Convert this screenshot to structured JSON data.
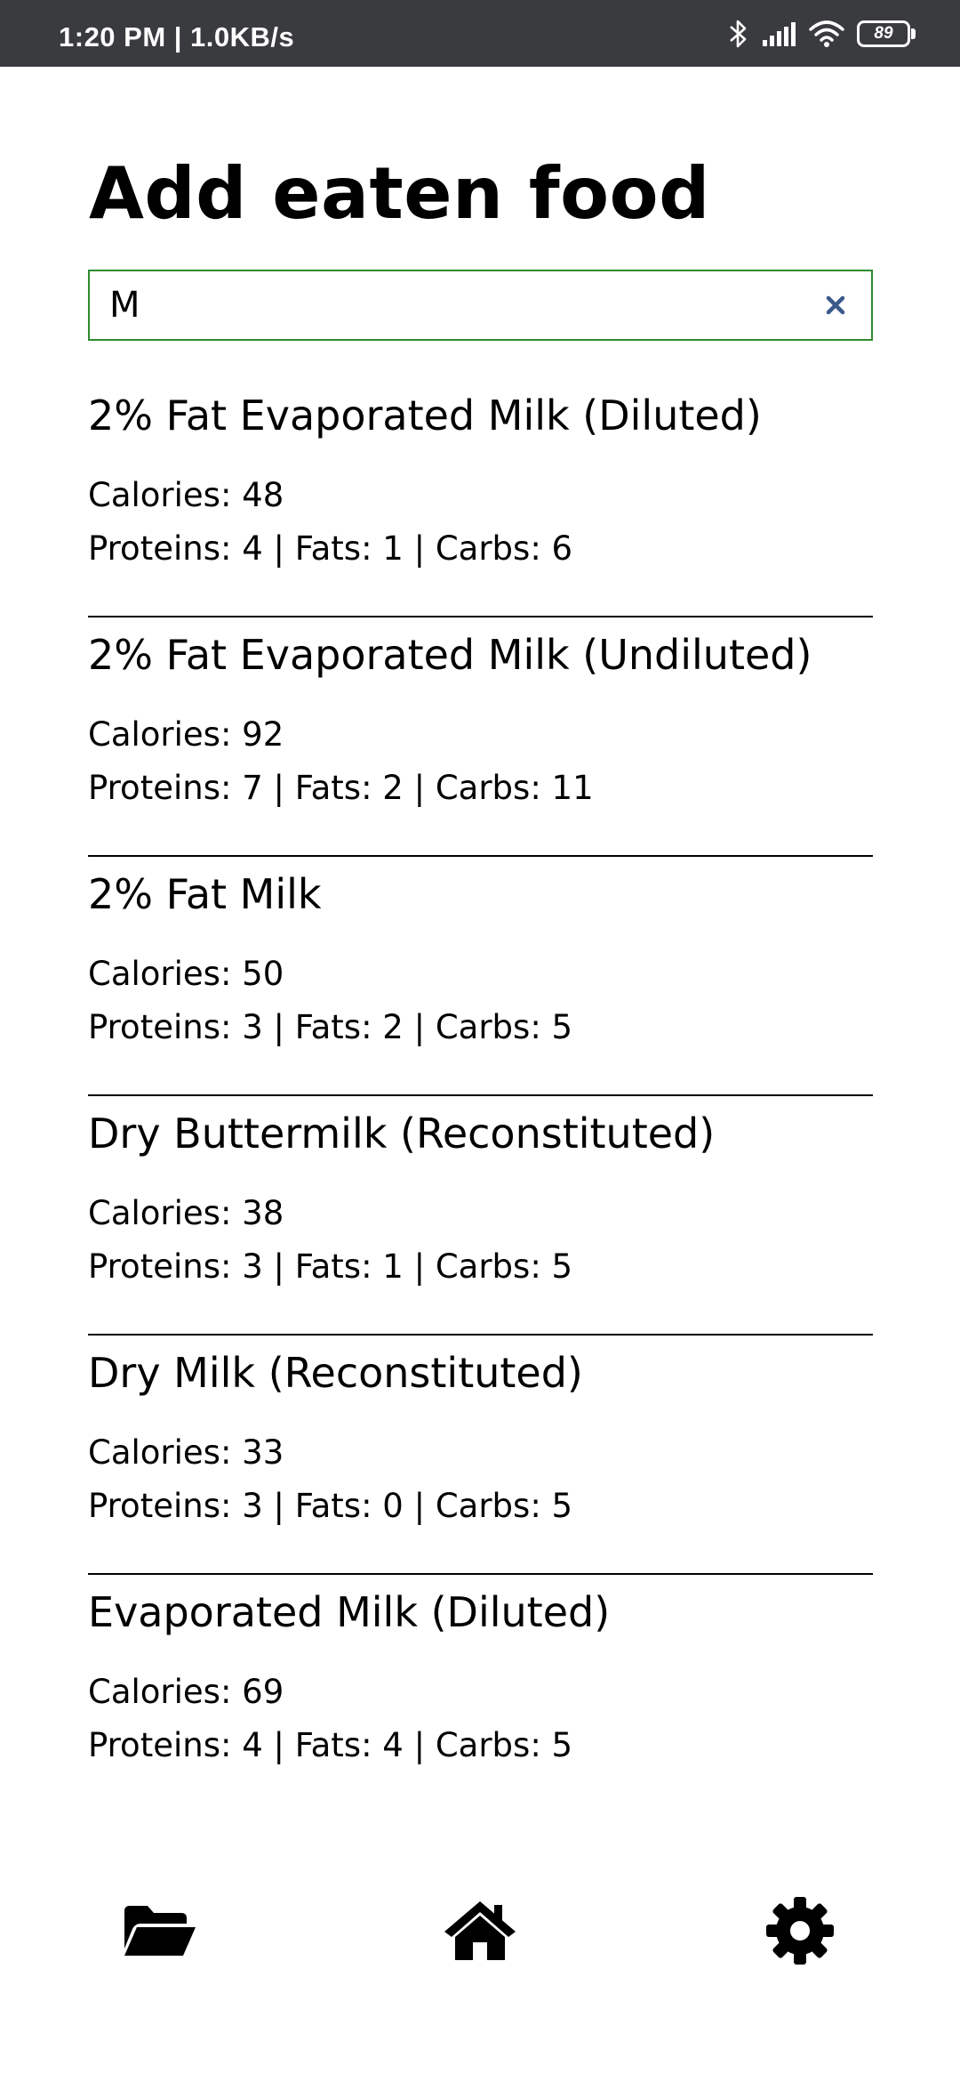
{
  "status_bar": {
    "time": "1:20 PM | 1.0KB/s",
    "battery": "89",
    "icons": [
      "bluetooth-icon",
      "signal-icon",
      "wifi-icon",
      "battery-icon"
    ]
  },
  "header": {
    "title": "Add eaten food"
  },
  "search": {
    "value": "M",
    "placeholder": "",
    "clear_icon": "close-icon"
  },
  "foods": [
    {
      "name": "2% Fat Evaporated Milk (Diluted)",
      "calories_text": "Calories: 48",
      "macros_text": "Proteins: 4 | Fats: 1 | Carbs: 6"
    },
    {
      "name": "2% Fat Evaporated Milk (Undiluted)",
      "calories_text": "Calories: 92",
      "macros_text": "Proteins: 7 | Fats: 2 | Carbs: 11"
    },
    {
      "name": "2% Fat Milk",
      "calories_text": "Calories: 50",
      "macros_text": "Proteins: 3 | Fats: 2 | Carbs: 5"
    },
    {
      "name": "Dry Buttermilk (Reconstituted)",
      "calories_text": "Calories: 38",
      "macros_text": "Proteins: 3 | Fats: 1 | Carbs: 5"
    },
    {
      "name": "Dry Milk (Reconstituted)",
      "calories_text": "Calories: 33",
      "macros_text": "Proteins: 3 | Fats: 0 | Carbs: 5"
    },
    {
      "name": "Evaporated Milk (Diluted)",
      "calories_text": "Calories: 69",
      "macros_text": "Proteins: 4 | Fats: 4 | Carbs: 5"
    }
  ],
  "bottom_nav": {
    "items": [
      "folder-open-icon",
      "home-icon",
      "gear-icon"
    ]
  },
  "colors": {
    "status_bar_bg": "#3a3b3f",
    "search_border": "#2e8b2e",
    "clear_icon": "#3b5a8c",
    "text": "#000000",
    "background": "#ffffff"
  }
}
